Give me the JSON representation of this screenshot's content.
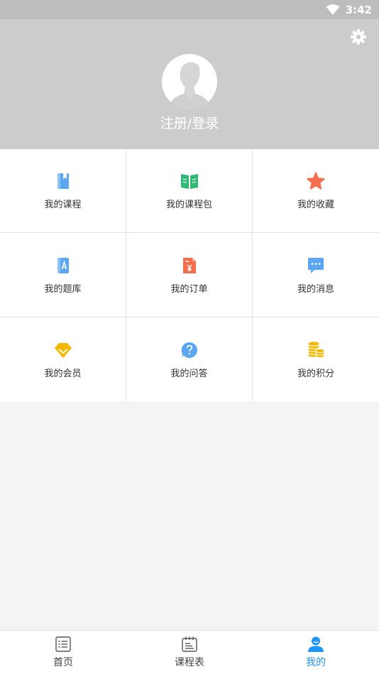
{
  "status_bar": {
    "time": "3:42"
  },
  "header": {
    "login_text": "注册/登录"
  },
  "grid": {
    "items": [
      {
        "label": "我的课程",
        "icon": "book-icon",
        "color": "#5aa6f3"
      },
      {
        "label": "我的课程包",
        "icon": "open-book-icon",
        "color": "#2eb872"
      },
      {
        "label": "我的收藏",
        "icon": "star-icon",
        "color": "#f46d4f"
      },
      {
        "label": "我的题库",
        "icon": "question-bank-icon",
        "color": "#5aa6f3"
      },
      {
        "label": "我的订单",
        "icon": "order-icon",
        "color": "#f46d4f"
      },
      {
        "label": "我的消息",
        "icon": "message-icon",
        "color": "#5aa6f3"
      },
      {
        "label": "我的会员",
        "icon": "vip-diamond-icon",
        "color": "#f5b800"
      },
      {
        "label": "我的问答",
        "icon": "question-icon",
        "color": "#5aa6f3"
      },
      {
        "label": "我的积分",
        "icon": "coins-icon",
        "color": "#f5b800"
      }
    ]
  },
  "tabbar": {
    "tabs": [
      {
        "label": "首页",
        "icon": "home-list-icon"
      },
      {
        "label": "课程表",
        "icon": "schedule-icon"
      },
      {
        "label": "我的",
        "icon": "user-icon",
        "active": true
      }
    ],
    "active_color": "#2196f3"
  }
}
